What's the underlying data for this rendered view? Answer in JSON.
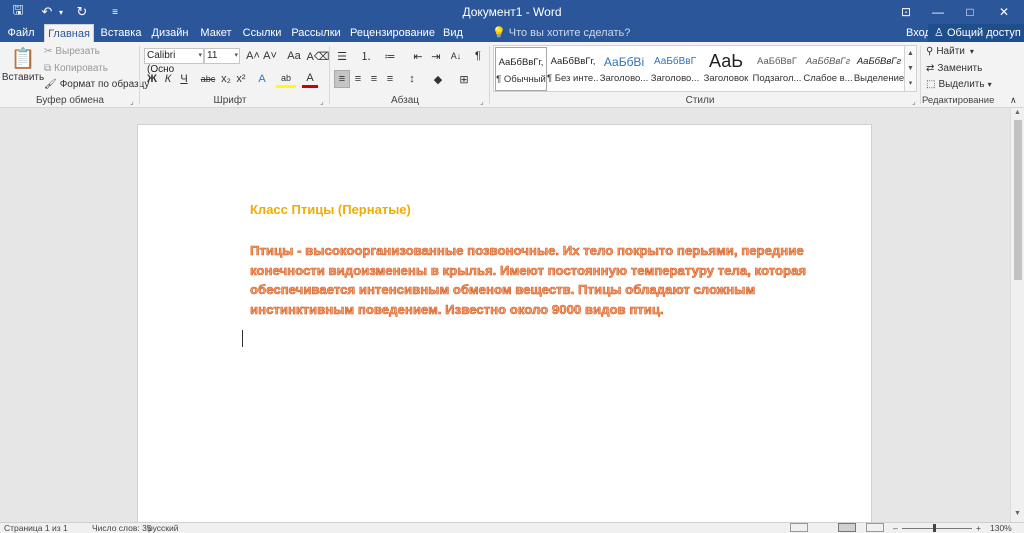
{
  "titlebar": {
    "title": "Документ1 - Word",
    "qa_icons": [
      "save-icon",
      "undo-icon",
      "redo-icon",
      "customize-icon"
    ],
    "qa_glyphs": {
      "save": "🖫",
      "undo": "↶",
      "undo_dd": "▾",
      "redo": "↻",
      "more": "≡"
    },
    "win_glyphs": {
      "ribbon_opts": "⊡",
      "minimize": "—",
      "maximize": "□",
      "close": "✕"
    }
  },
  "tabs": {
    "items": [
      "Файл",
      "Главная",
      "Вставка",
      "Дизайн",
      "Макет",
      "Ссылки",
      "Рассылки",
      "Рецензирование",
      "Вид"
    ],
    "active": "Главная",
    "tell_me": "Что вы хотите сделать?",
    "tell_me_icon": "💡",
    "sign_in": "Вход",
    "share": "Общий доступ",
    "share_icon": "♙"
  },
  "clipboard": {
    "paste": "Вставить",
    "paste_icon": "📋",
    "cut": "Вырезать",
    "copy": "Копировать",
    "format_painter": "Формат по образцу",
    "label": "Буфер обмена"
  },
  "font": {
    "name": "Calibri (Осно",
    "size": "11",
    "label": "Шрифт",
    "glyphs": {
      "grow": "A˄",
      "shrink": "A˅",
      "case": "Aa",
      "clear": "A⌫",
      "bold": "Ж",
      "italic": "К",
      "underline": "Ч",
      "strike": "abc",
      "sub": "x₂",
      "sup": "x²",
      "effects": "A",
      "highlight": "ab",
      "color": "A"
    }
  },
  "paragraph": {
    "label": "Абзац",
    "glyphs": {
      "bullets": "☰",
      "numbering": "⒈",
      "multilevel": "≔",
      "dec_indent": "⇤",
      "inc_indent": "⇥",
      "sort": "A↓",
      "marks": "¶",
      "align_left": "≡",
      "center": "≡",
      "align_right": "≡",
      "justify": "≡",
      "spacing": "↕",
      "shading": "◆",
      "borders": "⊞",
      "dropdown": "▾"
    }
  },
  "styles": {
    "label": "Стили",
    "items": [
      {
        "sample": "АаБбВвГг,",
        "name": "¶ Обычный"
      },
      {
        "sample": "АаБбВвГг,",
        "name": "¶ Без инте..."
      },
      {
        "sample": "АаБбВі",
        "name": "Заголово..."
      },
      {
        "sample": "АаБбВвГ",
        "name": "Заголово..."
      },
      {
        "sample": "АаЬ",
        "name": "Заголовок"
      },
      {
        "sample": "АаБбВвГ",
        "name": "Подзагол..."
      },
      {
        "sample": "АаБбВвГг",
        "name": "Слабое в..."
      },
      {
        "sample": "АаБбВвГг",
        "name": "Выделение"
      }
    ],
    "scroll_glyphs": {
      "up": "▲",
      "down": "▼",
      "more": "▾"
    }
  },
  "editing": {
    "find": "Найти",
    "replace": "Заменить",
    "select": "Выделить",
    "label": "Редактирование",
    "glyphs": {
      "find": "⚲",
      "replace": "⇄",
      "select": "⬚",
      "dropdown": "▾",
      "collapse": "∧"
    }
  },
  "colors": {
    "brand": "#2b579a",
    "heading_color": "#f0ad00",
    "body_fill": "#f8a070",
    "body_outline": "#d0581c"
  },
  "document": {
    "heading": "Класс Птицы (Пернатые)",
    "paragraph": "Птицы - высокоорганизованные позвоночные. Их тело покрыто перьями, передние конечности видоизменены в крылья. Имеют постоянную температуру тела, которая обеспечивается интенсивным обменом веществ. Птицы обладают сложным инстинктивным поведением. Известно около 9000 видов птиц."
  },
  "statusbar": {
    "page": "Страница 1 из 1",
    "words": "Число слов: 35",
    "language": "русский",
    "zoom": "130%",
    "glyphs": {
      "minus": "–",
      "plus": "+"
    }
  }
}
